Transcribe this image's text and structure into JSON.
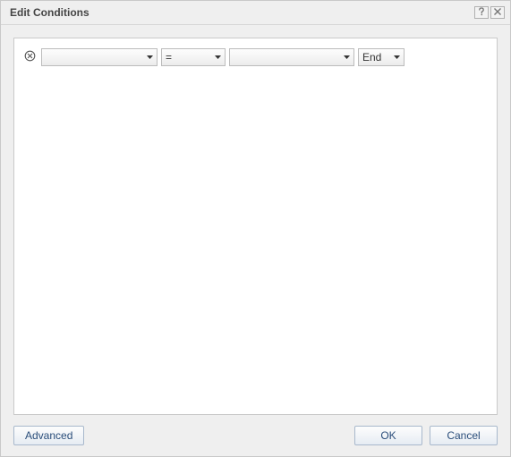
{
  "dialog": {
    "title": "Edit Conditions"
  },
  "row": {
    "field": "",
    "operator": "=",
    "value": "",
    "joiner": "End"
  },
  "footer": {
    "advanced": "Advanced",
    "ok": "OK",
    "cancel": "Cancel"
  }
}
